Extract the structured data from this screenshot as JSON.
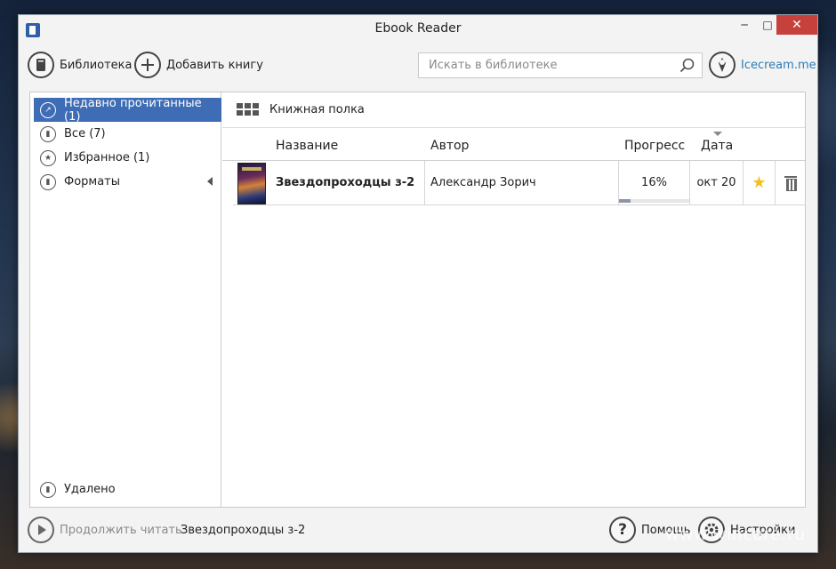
{
  "window": {
    "title": "Ebook Reader",
    "min_glyph": "─",
    "max_glyph": "□",
    "close_glyph": "✕"
  },
  "toolbar": {
    "library_label": "Библиотека",
    "add_book_label": "Добавить книгу",
    "search_placeholder": "Искать в библиотеке",
    "search_value": "",
    "icecream_label": "Icecream.me"
  },
  "sidebar": {
    "items": [
      {
        "label": "Недавно прочитанные (1)",
        "icon": "recent-icon",
        "active": true
      },
      {
        "label": "Все (7)",
        "icon": "book-icon",
        "active": false
      },
      {
        "label": "Избранное (1)",
        "icon": "star-icon",
        "active": false
      },
      {
        "label": "Форматы",
        "icon": "bookmark-icon",
        "active": false
      }
    ],
    "deleted_label": "Удалено"
  },
  "shelf": {
    "label": "Книжная полка"
  },
  "table": {
    "columns": [
      "Название",
      "Автор",
      "Прогресс",
      "Дата"
    ],
    "rows": [
      {
        "title": "Звездопроходцы з-2",
        "author": "Александр Зорич",
        "progress": "16%",
        "progress_value": 16,
        "date": "окт 20",
        "favorite": true
      }
    ]
  },
  "statusbar": {
    "continue_label": "Продолжить читать",
    "current_book": "Звездопроходцы з-2",
    "help_label": "Помощь",
    "settings_label": "Настройки"
  },
  "watermark": "www.wincore.ru",
  "colors": {
    "accent": "#3e6db5",
    "close_button": "#c7413c",
    "link": "#2a7db8",
    "star": "#f0c020"
  }
}
